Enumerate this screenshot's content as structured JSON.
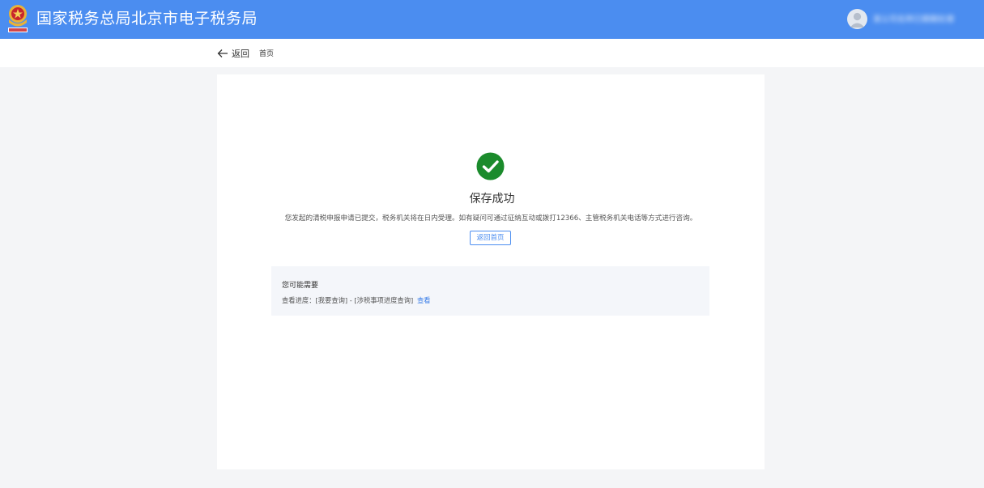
{
  "header": {
    "title": "国家税务总局北京市电子税务局",
    "user_name": "某公司名称已模糊处理",
    "emblem_icon": "tax-emblem-icon",
    "avatar_icon": "user-avatar-icon",
    "background": "#4b8df0"
  },
  "subnav": {
    "back_label": "返回",
    "back_icon": "arrow-left-icon",
    "home_label": "首页"
  },
  "result": {
    "icon": "check-circle-icon",
    "icon_color": "#1b8b2c",
    "title": "保存成功",
    "description": "您发起的清税申报申请已提交，税务机关将在日内受理。如有疑问可通过征纳互动或拨打12366、主管税务机关电话等方式进行咨询。",
    "home_button": "返回首页"
  },
  "suggestions": {
    "title": "您可能需要",
    "row_text": "查看进度：[我要查询] - [涉税事项进度查询]",
    "row_link": "查看"
  }
}
